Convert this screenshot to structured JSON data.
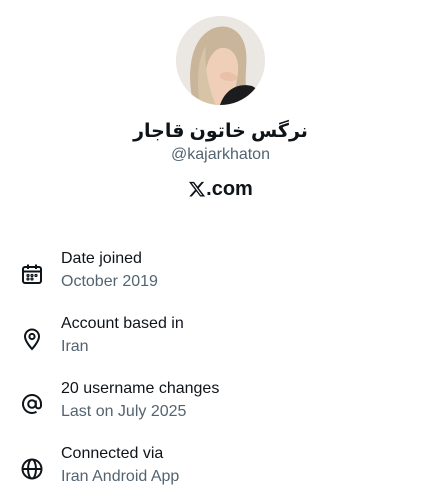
{
  "profile": {
    "display_name": "نرگس خاتون قاجار",
    "handle": "@kajarkhaton",
    "site": ".com",
    "site_logo_icon": "x-logo-icon",
    "avatar_icon": "profile-photo"
  },
  "details": [
    {
      "icon": "calendar-icon",
      "title": "Date joined",
      "value": "October 2019"
    },
    {
      "icon": "location-pin-icon",
      "title": "Account based in",
      "value": "Iran"
    },
    {
      "icon": "at-sign-icon",
      "title": "20 username changes",
      "value": "Last on July 2025"
    },
    {
      "icon": "globe-icon",
      "title": "Connected via",
      "value": "Iran Android App"
    }
  ],
  "colors": {
    "text": "#0f1419",
    "secondary": "#536471",
    "background": "#ffffff"
  }
}
